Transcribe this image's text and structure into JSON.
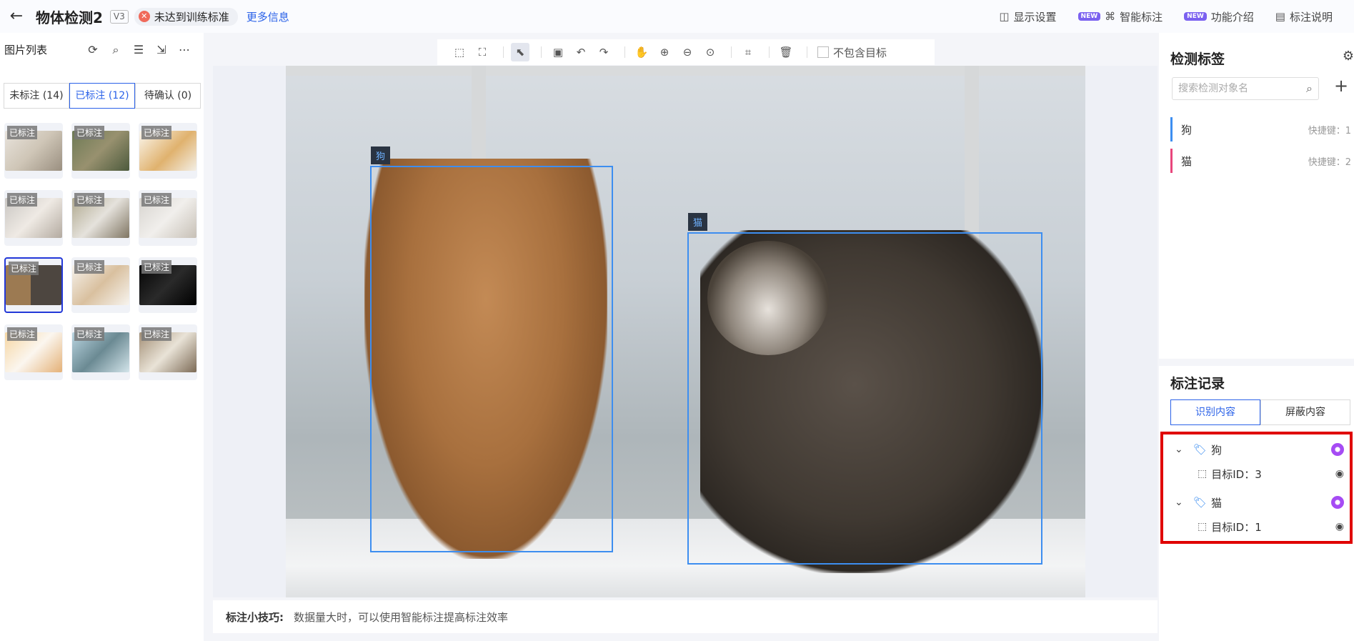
{
  "header": {
    "title": "物体检测2",
    "version": "V3",
    "status": "未达到训练标准",
    "more_info": "更多信息",
    "display_settings": "显示设置",
    "smart_label": "智能标注",
    "feature_intro": "功能介绍",
    "label_guide": "标注说明",
    "new_badge": "NEW"
  },
  "left": {
    "title": "图片列表",
    "tabs": [
      "未标注 (14)",
      "已标注 (12)",
      "待确认 (0)"
    ],
    "thumb_label": "已标注",
    "thumb_count": 12
  },
  "toolbar": {
    "exclude_target": "不包含目标"
  },
  "canvas": {
    "boxes": [
      {
        "label": "狗"
      },
      {
        "label": "猫"
      }
    ]
  },
  "tips": {
    "title": "标注小技巧:",
    "text": "数据量大时，可以使用智能标注提高标注效率"
  },
  "right": {
    "labels_title": "检测标签",
    "search_placeholder": "搜索检测对象名",
    "labels": [
      {
        "name": "狗",
        "shortcut": "快捷键：1",
        "color": "#3d8ef0"
      },
      {
        "name": "猫",
        "shortcut": "快捷键：2",
        "color": "#e8467c"
      }
    ],
    "records_title": "标注记录",
    "record_tabs": [
      "识别内容",
      "屏蔽内容"
    ],
    "records": [
      {
        "label": "狗",
        "target": "目标ID：3"
      },
      {
        "label": "猫",
        "target": "目标ID：1"
      }
    ]
  }
}
